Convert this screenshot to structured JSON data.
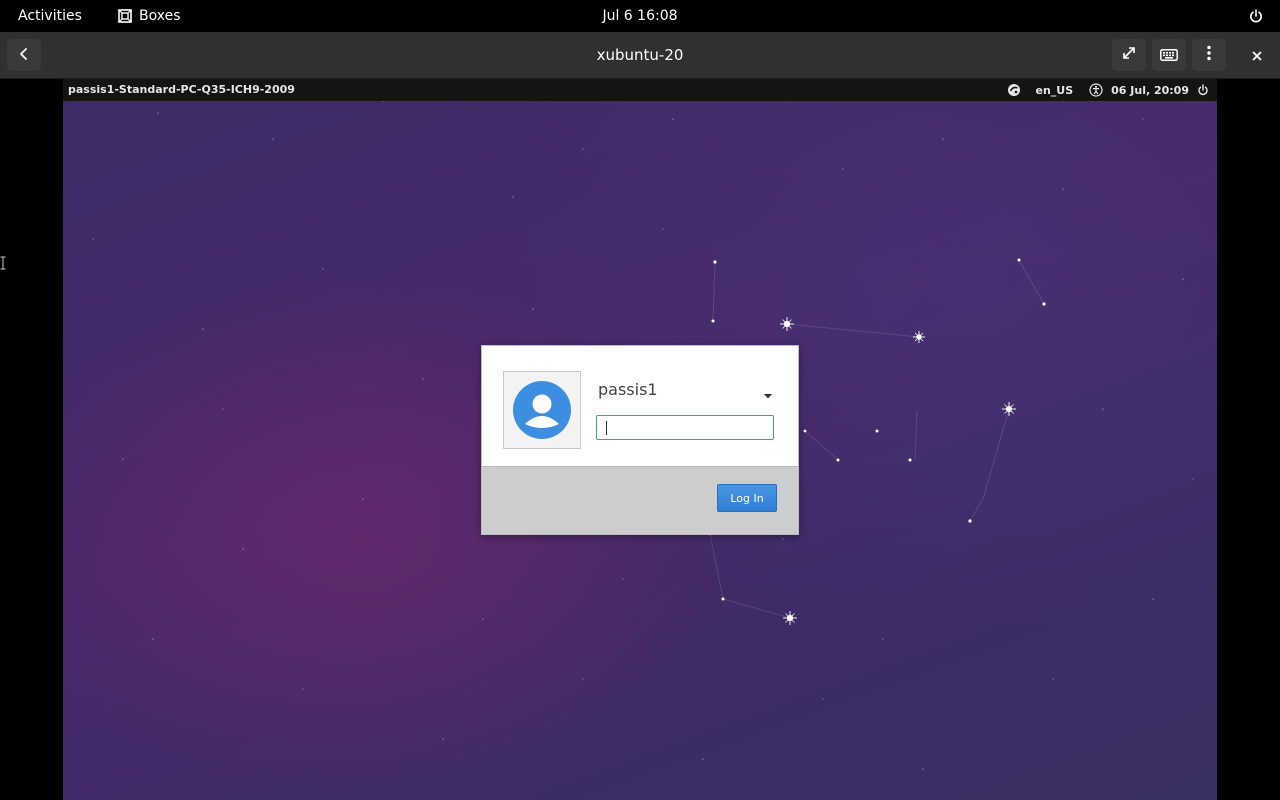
{
  "top_bar": {
    "activities": "Activities",
    "app_name": "Boxes",
    "app_icon": "boxes-icon",
    "clock": "Jul 6  16:08",
    "power_icon": "power-icon"
  },
  "header_bar": {
    "title": "xubuntu-20",
    "back_icon": "back-arrow-icon",
    "fullscreen_icon": "fullscreen-icon",
    "keyboard_icon": "keyboard-icon",
    "menu_icon": "kebab-menu-icon",
    "close_icon": "close-icon"
  },
  "vm": {
    "panel": {
      "hostname": "passis1-Standard-PC-Q35-ICH9-2009",
      "session_icon": "session-icon",
      "language": "en_US",
      "accessibility_icon": "accessibility-icon",
      "datetime": "06 Jul, 20:09",
      "power_icon": "power-icon"
    },
    "login": {
      "username": "passis1",
      "password_value": "",
      "login_button": "Log In",
      "avatar_icon": "user-avatar-icon",
      "dropdown_icon": "dropdown-arrow-icon"
    }
  },
  "colors": {
    "top_bar_bg": "#000000",
    "header_bar_bg": "#303030",
    "wallpaper": "#45296a",
    "login_button": "#3585dc",
    "avatar": "#3d8ee0"
  }
}
